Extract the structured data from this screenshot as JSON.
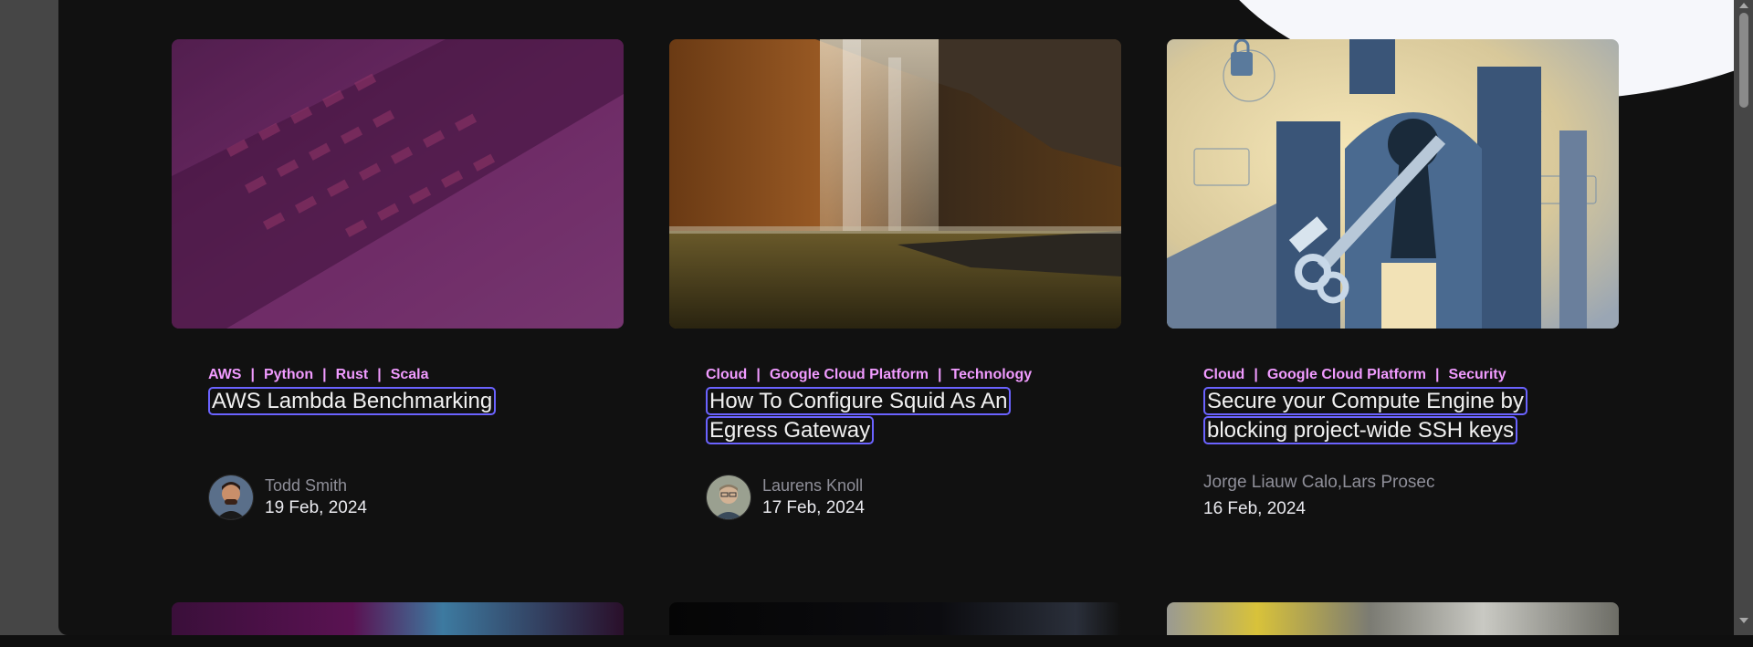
{
  "cards": [
    {
      "tags": [
        "AWS",
        "Python",
        "Rust",
        "Scala"
      ],
      "title": "AWS Lambda Benchmarking",
      "author": "Todd Smith",
      "date": "19 Feb, 2024",
      "image": "laptop-keyboard-photo"
    },
    {
      "tags": [
        "Cloud",
        "Google Cloud Platform",
        "Technology"
      ],
      "title": "How To Configure Squid As An Egress Gateway",
      "author": "Laurens Knoll",
      "date": "17 Feb, 2024",
      "image": "waterfall-cave-photo"
    },
    {
      "tags": [
        "Cloud",
        "Google Cloud Platform",
        "Security"
      ],
      "title": "Secure your Compute Engine by blocking project-wide SSH keys",
      "author": "Jorge Liauw Calo,Lars Prosec",
      "date": "16 Feb, 2024",
      "image": "castle-key-illustration"
    }
  ],
  "colors": {
    "tag": "#f19bff",
    "focus_outline": "#6b63ff",
    "background": "#111111"
  }
}
